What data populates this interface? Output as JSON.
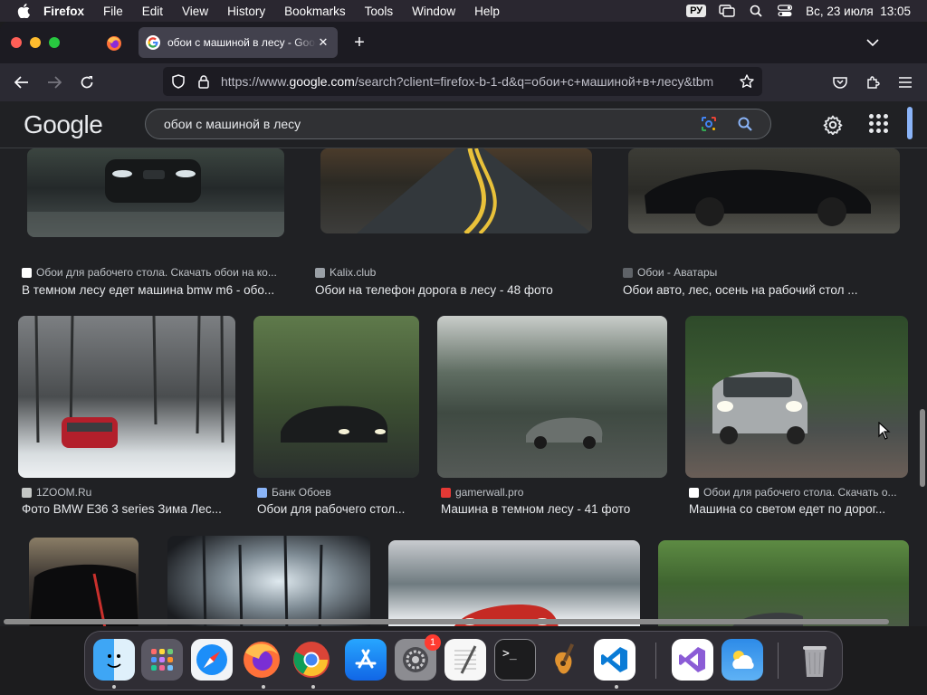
{
  "menubar": {
    "app": "Firefox",
    "items": [
      "File",
      "Edit",
      "View",
      "History",
      "Bookmarks",
      "Tools",
      "Window",
      "Help"
    ],
    "input_source": "РУ",
    "datetime": "Вс, 23 июля  13:05"
  },
  "browser": {
    "tab_title": "обои с машиной в лесу - Google",
    "url_prefix": "https://www.",
    "url_domain": "google.com",
    "url_rest": "/search?client=firefox-b-1-d&q=обои+с+машиной+в+лесу&tbm"
  },
  "google": {
    "logo": "Google",
    "query": "обои с машиной в лесу"
  },
  "results": [
    {
      "source": "Обои для рабочего стола. Скачать обои на ко...",
      "title": "В темном лесу едет машина bmw m6 - обо..."
    },
    {
      "source": "Kalix.club",
      "title": "Обои на телефон дорога в лесу - 48 фото"
    },
    {
      "source": "Обои - Аватары",
      "title": "Обои авто, лес, осень на рабочий стол ..."
    },
    {
      "source": "1ZOOM.Ru",
      "title": "Фото BMW E36 3 series Зима Лес..."
    },
    {
      "source": "Банк Обоев",
      "title": "Обои для рабочего стол..."
    },
    {
      "source": "gamerwall.pro",
      "title": "Машина в темном лесу - 41 фото"
    },
    {
      "source": "Обои для рабочего стола. Скачать о...",
      "title": "Машина со светом едет по дорог..."
    }
  ],
  "dock": {
    "items": [
      "Finder",
      "Launchpad",
      "Safari",
      "Firefox",
      "Chrome",
      "App Store",
      "System Settings",
      "TextEdit",
      "Terminal",
      "Instruments",
      "VS Code",
      "Visual Studio",
      "Weather",
      "Trash"
    ],
    "settings_badge": "1"
  },
  "colors": {
    "page_bg": "#202124",
    "accent_blue": "#8ab4f8",
    "tab_bg": "#42414d"
  }
}
